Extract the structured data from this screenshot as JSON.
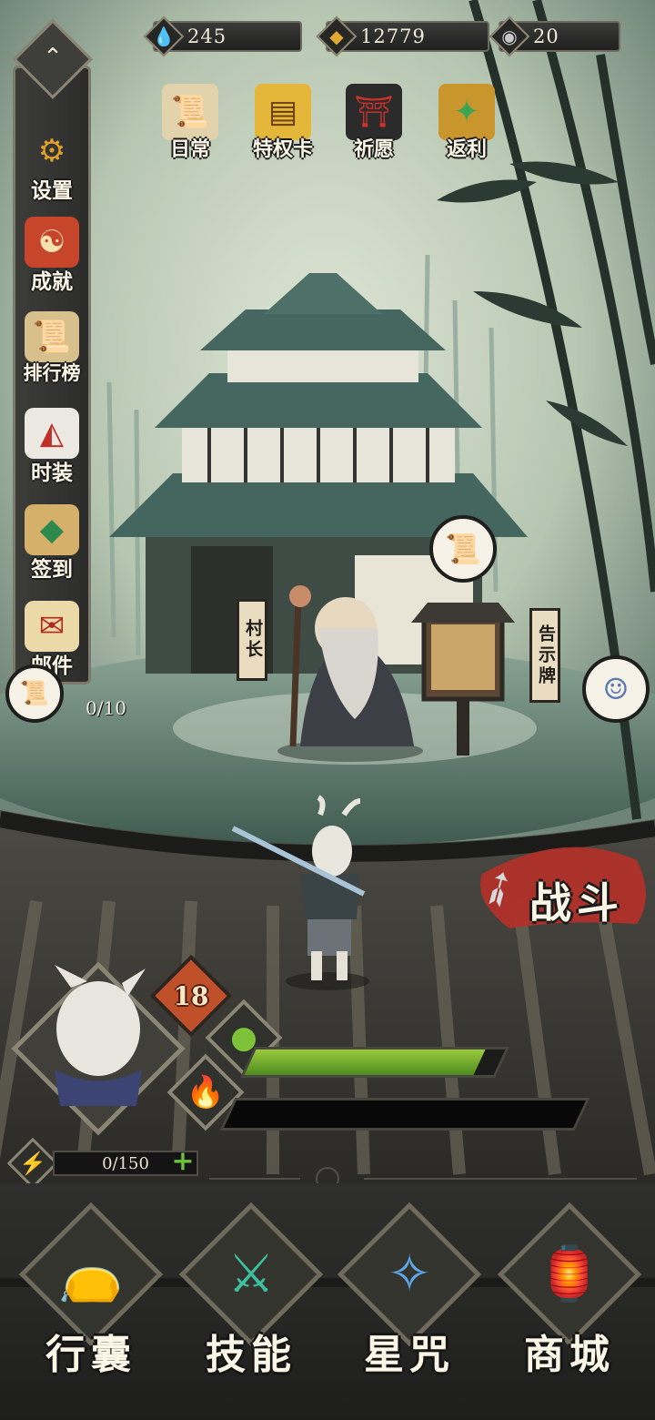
{
  "currencies": {
    "jade": "245",
    "coin": "12779",
    "orb": "20"
  },
  "activities": [
    {
      "label": "日常",
      "icon": "scroll-icon"
    },
    {
      "label": "特权卡",
      "icon": "privilege-card-icon"
    },
    {
      "label": "祈愿",
      "icon": "torii-gate-icon"
    },
    {
      "label": "返利",
      "icon": "treasure-chest-icon"
    }
  ],
  "side_menu": [
    {
      "label": "设置",
      "icon": "gear-icon"
    },
    {
      "label": "成就",
      "icon": "achievement-icon"
    },
    {
      "label": "排行榜",
      "icon": "ranking-scroll-icon"
    },
    {
      "label": "时装",
      "icon": "fox-mask-icon"
    },
    {
      "label": "签到",
      "icon": "signin-icon"
    },
    {
      "label": "邮件",
      "icon": "mail-icon"
    }
  ],
  "mail_progress": "0/10",
  "signs": {
    "village_chief": "村长",
    "notice_board": "告示牌"
  },
  "battle_label": "战斗",
  "player": {
    "level": "18",
    "hp_fill": 0.92,
    "mp_fill": 0.0,
    "energy": "0/150"
  },
  "bottom_nav": [
    {
      "label": "行囊",
      "icon": "bag-icon"
    },
    {
      "label": "技能",
      "icon": "skill-blade-icon"
    },
    {
      "label": "星咒",
      "icon": "star-map-icon"
    },
    {
      "label": "商城",
      "icon": "shop-icon"
    }
  ],
  "colors": {
    "sky": "#b9c8b6",
    "ground": "#4b6a5e",
    "roof": "#3a3a37",
    "hp": "#8cc23a",
    "energy": "#2fa0e0"
  }
}
